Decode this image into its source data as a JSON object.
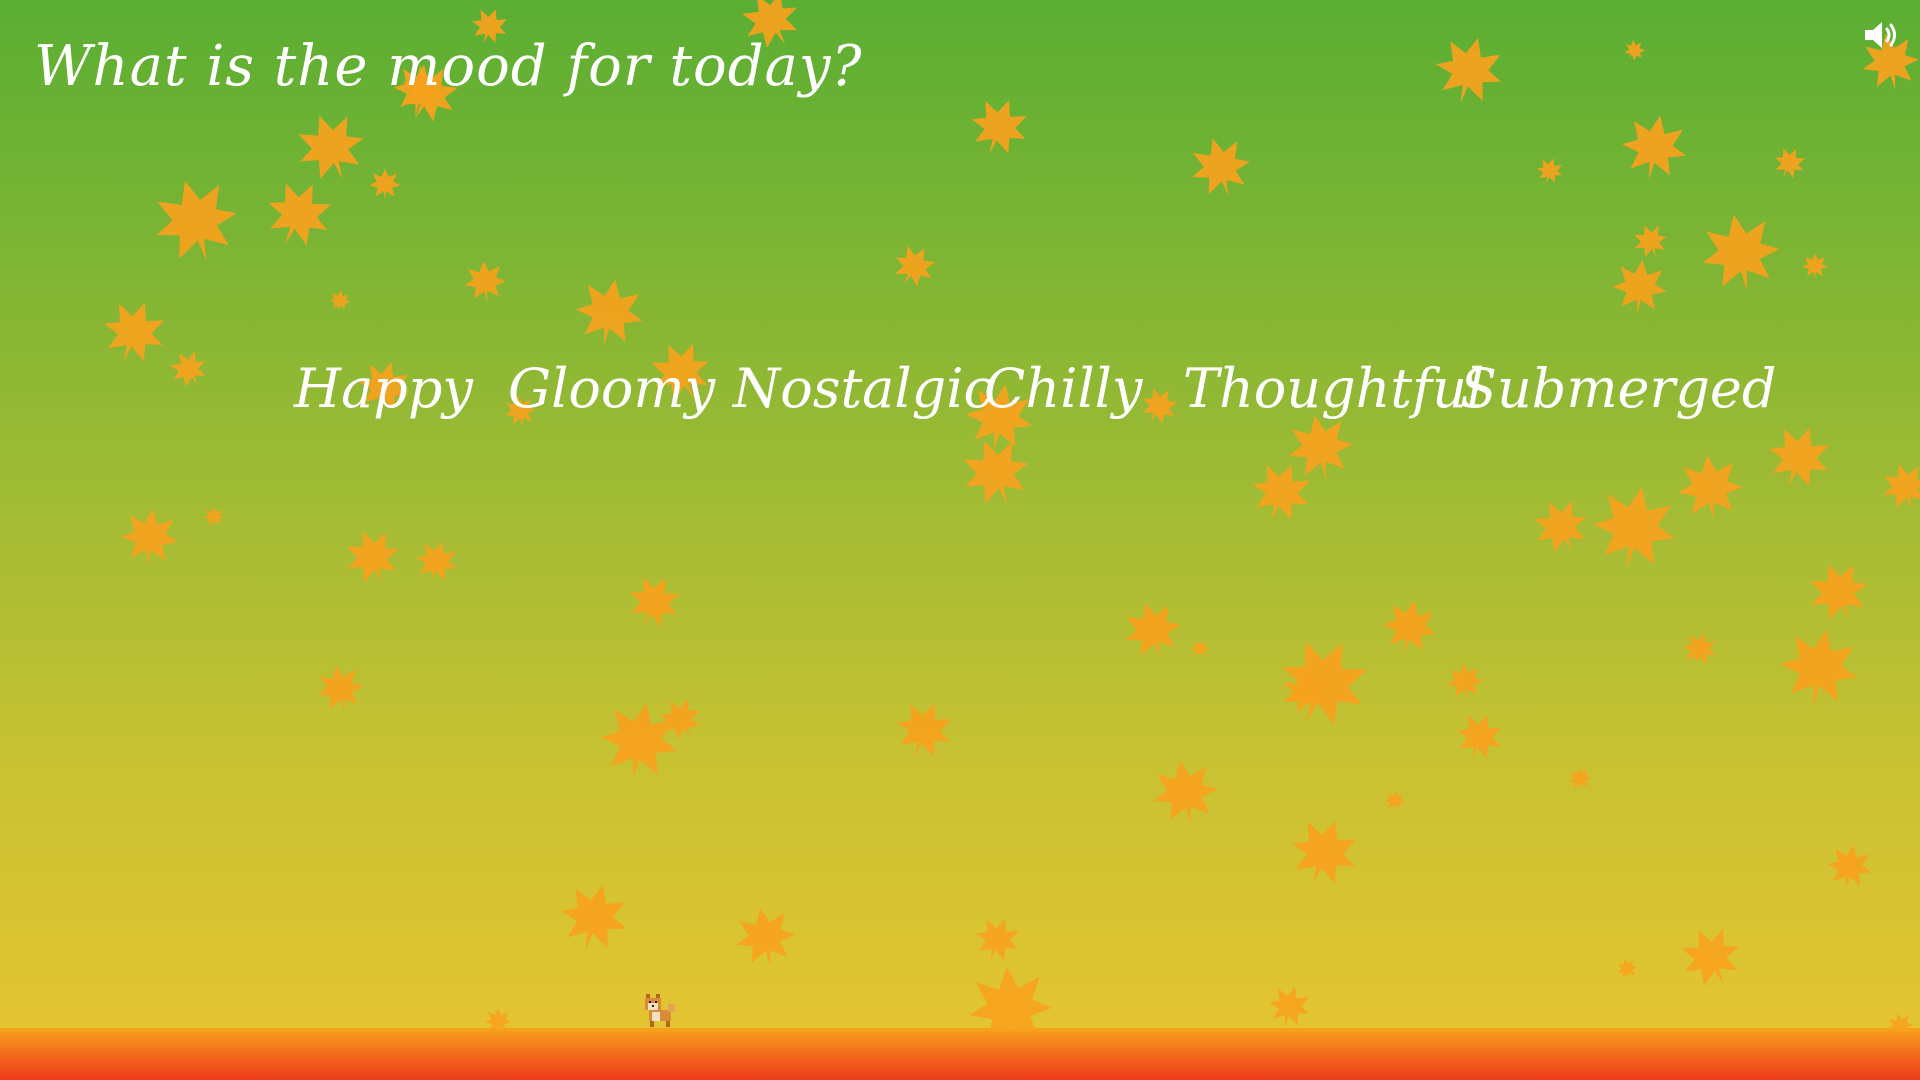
{
  "game": {
    "title": "What is the mood for today?",
    "moods": [
      "Happy",
      "Gloomy",
      "Nostalgic",
      "Chilly",
      "Thoughtful",
      "Submerged"
    ],
    "sound_icon": "speaker-volume-icon",
    "character_icon": "pixel-shiba-dog-icon"
  },
  "colors": {
    "sky_top": "#5aae33",
    "sky_bottom": "#e9c532",
    "leaf": "#f7a21d",
    "ground_top": "#f7a31c",
    "ground_bottom": "#ec3a1b",
    "text": "#ffffff"
  }
}
